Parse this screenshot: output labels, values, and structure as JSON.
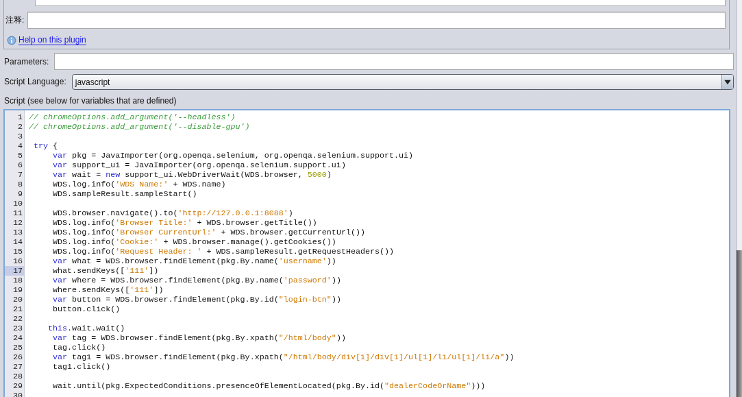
{
  "comment_field": {
    "label": "注释:"
  },
  "help_link": "Help on this plugin",
  "parameters": {
    "label": "Parameters:"
  },
  "script_language": {
    "label": "Script Language:",
    "value": "javascript"
  },
  "script": {
    "label": "Script (see below for variables that are defined)",
    "lines": [
      {
        "number": "1",
        "current": false,
        "tokens": [
          {
            "kind": "comment",
            "text": "// chromeOptions.add_argument('--headless')"
          }
        ]
      },
      {
        "number": "2",
        "current": false,
        "tokens": [
          {
            "kind": "comment",
            "text": "// chromeOptions.add_argument('--disable-gpu')"
          }
        ]
      },
      {
        "number": "3",
        "current": false
      },
      {
        "number": "4",
        "current": false,
        "tokens": [
          {
            "kind": "keyword",
            "text": " try"
          },
          {
            "kind": "plain",
            "text": " {"
          }
        ]
      },
      {
        "number": "5",
        "current": false,
        "tokens": [
          {
            "kind": "keyword",
            "text": "     var"
          },
          {
            "kind": "plain",
            "text": " pkg = JavaImporter(org.openqa.selenium, org.openqa.selenium.support.ui)"
          }
        ]
      },
      {
        "number": "6",
        "current": false,
        "tokens": [
          {
            "kind": "keyword",
            "text": "     var"
          },
          {
            "kind": "plain",
            "text": " support_ui = JavaImporter(org.openqa.selenium.support.ui)"
          }
        ]
      },
      {
        "number": "7",
        "current": false,
        "tokens": [
          {
            "kind": "keyword",
            "text": "     var"
          },
          {
            "kind": "plain",
            "text": " wait = "
          },
          {
            "kind": "keyword",
            "text": "new"
          },
          {
            "kind": "plain",
            "text": " support_ui.WebDriverWait(WDS.browser, "
          },
          {
            "kind": "number",
            "text": "5000"
          },
          {
            "kind": "plain",
            "text": ")"
          }
        ]
      },
      {
        "number": "8",
        "current": false,
        "tokens": [
          {
            "kind": "plain",
            "text": "     WDS.log.info("
          },
          {
            "kind": "string",
            "text": "'WDS Name:'"
          },
          {
            "kind": "plain",
            "text": " + WDS.name)"
          }
        ]
      },
      {
        "number": "9",
        "current": false,
        "tokens": [
          {
            "kind": "plain",
            "text": "     WDS.sampleResult.sampleStart()"
          }
        ]
      },
      {
        "number": "10",
        "current": false
      },
      {
        "number": "11",
        "current": false,
        "tokens": [
          {
            "kind": "plain",
            "text": "     WDS.browser.navigate().to("
          },
          {
            "kind": "string",
            "text": "'http://127.0.0.1:8088'"
          },
          {
            "kind": "plain",
            "text": ")"
          }
        ]
      },
      {
        "number": "12",
        "current": false,
        "tokens": [
          {
            "kind": "plain",
            "text": "     WDS.log.info("
          },
          {
            "kind": "string",
            "text": "'Browser Title:'"
          },
          {
            "kind": "plain",
            "text": " + WDS.browser.getTitle())"
          }
        ]
      },
      {
        "number": "13",
        "current": false,
        "tokens": [
          {
            "kind": "plain",
            "text": "     WDS.log.info("
          },
          {
            "kind": "string",
            "text": "'Browser CurrentUrl:'"
          },
          {
            "kind": "plain",
            "text": " + WDS.browser.getCurrentUrl())"
          }
        ]
      },
      {
        "number": "14",
        "current": false,
        "tokens": [
          {
            "kind": "plain",
            "text": "     WDS.log.info("
          },
          {
            "kind": "string",
            "text": "'Cookie:'"
          },
          {
            "kind": "plain",
            "text": " + WDS.browser.manage().getCookies())"
          }
        ]
      },
      {
        "number": "15",
        "current": false,
        "tokens": [
          {
            "kind": "plain",
            "text": "     WDS.log.info("
          },
          {
            "kind": "string",
            "text": "'Request Header: '"
          },
          {
            "kind": "plain",
            "text": " + WDS.sampleResult.getRequestHeaders())"
          }
        ]
      },
      {
        "number": "16",
        "current": false,
        "tokens": [
          {
            "kind": "keyword",
            "text": "     var"
          },
          {
            "kind": "plain",
            "text": " what = WDS.browser.findElement(pkg.By.name("
          },
          {
            "kind": "string",
            "text": "'username'"
          },
          {
            "kind": "plain",
            "text": "))"
          }
        ]
      },
      {
        "number": "17",
        "current": true,
        "tokens": [
          {
            "kind": "plain",
            "text": "     what.sendKeys(["
          },
          {
            "kind": "string",
            "text": "'111'"
          },
          {
            "kind": "plain",
            "text": "])"
          }
        ]
      },
      {
        "number": "18",
        "current": false,
        "tokens": [
          {
            "kind": "keyword",
            "text": "     var"
          },
          {
            "kind": "plain",
            "text": " where = WDS.browser.findElement(pkg.By.name("
          },
          {
            "kind": "string",
            "text": "'password'"
          },
          {
            "kind": "plain",
            "text": "))"
          }
        ]
      },
      {
        "number": "19",
        "current": false,
        "tokens": [
          {
            "kind": "plain",
            "text": "     where.sendKeys(["
          },
          {
            "kind": "string",
            "text": "'111'"
          },
          {
            "kind": "plain",
            "text": "])"
          }
        ]
      },
      {
        "number": "20",
        "current": false,
        "tokens": [
          {
            "kind": "keyword",
            "text": "     var"
          },
          {
            "kind": "plain",
            "text": " button = WDS.browser.findElement(pkg.By.id("
          },
          {
            "kind": "string",
            "text": "\"login-btn\""
          },
          {
            "kind": "plain",
            "text": "))"
          }
        ]
      },
      {
        "number": "21",
        "current": false,
        "tokens": [
          {
            "kind": "plain",
            "text": "     button.click()"
          }
        ]
      },
      {
        "number": "22",
        "current": false
      },
      {
        "number": "23",
        "current": false,
        "tokens": [
          {
            "kind": "keyword",
            "text": "    this"
          },
          {
            "kind": "plain",
            "text": ".wait.wait()"
          }
        ]
      },
      {
        "number": "24",
        "current": false,
        "tokens": [
          {
            "kind": "keyword",
            "text": "     var"
          },
          {
            "kind": "plain",
            "text": " tag = WDS.browser.findElement(pkg.By.xpath("
          },
          {
            "kind": "string",
            "text": "\"/html/body\""
          },
          {
            "kind": "plain",
            "text": "))"
          }
        ]
      },
      {
        "number": "25",
        "current": false,
        "tokens": [
          {
            "kind": "plain",
            "text": "     tag.click()"
          }
        ]
      },
      {
        "number": "26",
        "current": false,
        "tokens": [
          {
            "kind": "keyword",
            "text": "     var"
          },
          {
            "kind": "plain",
            "text": " tag1 = WDS.browser.findElement(pkg.By.xpath("
          },
          {
            "kind": "string",
            "text": "\"/html/body/div[1]/div[1]/ul[1]/li/ul[1]/li/a\""
          },
          {
            "kind": "plain",
            "text": "))"
          }
        ]
      },
      {
        "number": "27",
        "current": false,
        "tokens": [
          {
            "kind": "plain",
            "text": "     tag1.click()"
          }
        ]
      },
      {
        "number": "28",
        "current": false
      },
      {
        "number": "29",
        "current": false,
        "tokens": [
          {
            "kind": "plain",
            "text": "     wait.until(pkg.ExpectedConditions.presenceOfElementLocated(pkg.By.id("
          },
          {
            "kind": "string",
            "text": "\"dealerCodeOrName\""
          },
          {
            "kind": "plain",
            "text": ")))"
          }
        ]
      },
      {
        "number": "30",
        "current": false
      }
    ]
  }
}
